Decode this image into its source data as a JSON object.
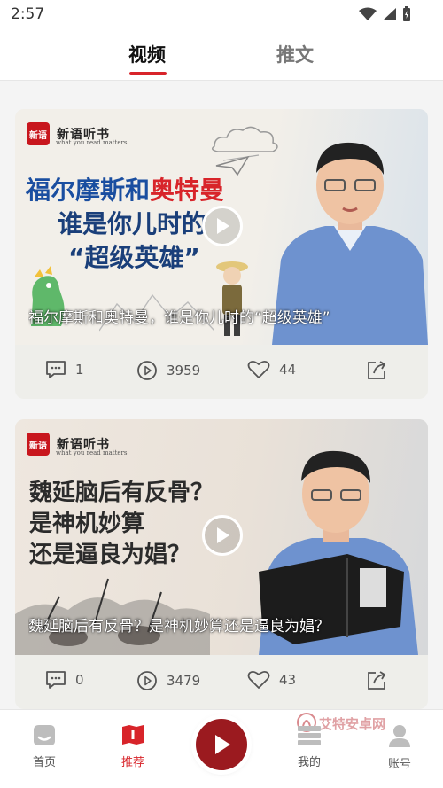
{
  "status_bar": {
    "time": "2:57"
  },
  "tabs": [
    {
      "label": "视频",
      "active": true
    },
    {
      "label": "推文",
      "active": false
    }
  ],
  "colors": {
    "accent": "#d8242a",
    "play_button": "#9b1a1f",
    "tab_inactive": "#777777"
  },
  "brand": {
    "name": "新语听书",
    "tagline": "what you read matters",
    "mark": "新语"
  },
  "videos": [
    {
      "poster_lines": [
        "福尔摩斯和奥特曼",
        "谁是你儿时的",
        "“超级英雄”"
      ],
      "poster_red": "奥特曼",
      "title": "福尔摩斯和奥特曼，谁是你儿时的“超级英雄”",
      "comments": "1",
      "views": "3959",
      "likes": "44"
    },
    {
      "poster_lines": [
        "魏延脑后有反骨？",
        "是神机妙算",
        "还是逼良为娼？"
      ],
      "title": "魏延脑后有反骨？是神机妙算还是逼良为娼？",
      "comments": "0",
      "views": "3479",
      "likes": "43"
    }
  ],
  "bottom_nav": [
    {
      "label": "首页",
      "icon": "home-icon"
    },
    {
      "label": "推荐",
      "icon": "recommend-icon",
      "active": true
    },
    {
      "label": "",
      "icon": "play-icon"
    },
    {
      "label": "我的",
      "icon": "bookshelf-icon"
    },
    {
      "label": "账号",
      "icon": "person-icon"
    }
  ],
  "watermark": "艾特安卓网"
}
